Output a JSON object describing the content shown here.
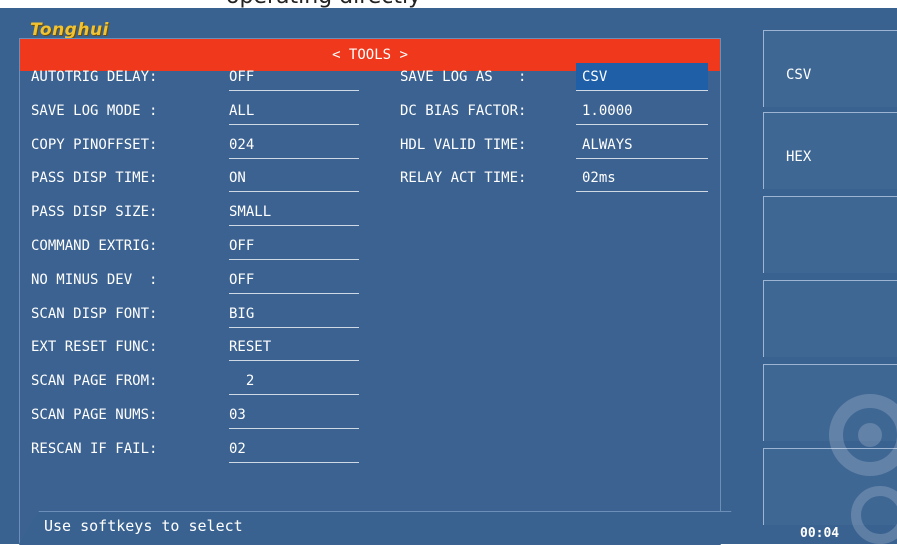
{
  "brand": {
    "logo_text": "Tonghui",
    "top_fragment": "operating directly"
  },
  "panel": {
    "title": "< TOOLS >"
  },
  "left_fields": [
    {
      "label": "AUTOTRIG DELAY:",
      "value": "OFF"
    },
    {
      "label": "SAVE LOG MODE :",
      "value": "ALL"
    },
    {
      "label": "COPY PINOFFSET:",
      "value": "024"
    },
    {
      "label": "PASS DISP TIME:",
      "value": "ON"
    },
    {
      "label": "PASS DISP SIZE:",
      "value": "SMALL"
    },
    {
      "label": "COMMAND EXTRIG:",
      "value": "OFF"
    },
    {
      "label": "NO MINUS DEV  :",
      "value": "OFF"
    },
    {
      "label": "SCAN DISP FONT:",
      "value": "BIG"
    },
    {
      "label": "EXT RESET FUNC:",
      "value": "RESET"
    },
    {
      "label": "SCAN PAGE FROM:",
      "value": "  2"
    },
    {
      "label": "SCAN PAGE NUMS:",
      "value": "03"
    },
    {
      "label": "RESCAN IF FAIL:",
      "value": "02"
    }
  ],
  "right_fields": [
    {
      "label": "SAVE LOG AS   :",
      "value": "CSV",
      "selected": true
    },
    {
      "label": "DC BIAS FACTOR:",
      "value": "1.0000"
    },
    {
      "label": "HDL VALID TIME:",
      "value": "ALWAYS"
    },
    {
      "label": "RELAY ACT TIME:",
      "value": "02ms"
    }
  ],
  "softkeys": [
    {
      "label": "CSV"
    },
    {
      "label": "HEX"
    },
    {
      "label": ""
    },
    {
      "label": ""
    },
    {
      "label": ""
    },
    {
      "label": ""
    }
  ],
  "status": {
    "message": "Use softkeys to select"
  },
  "clock": {
    "time": "00:04"
  },
  "colors": {
    "background": "#3a6290",
    "title_bar": "#f0391c",
    "selection": "#1e5fa8",
    "logo": "#f1c232"
  }
}
